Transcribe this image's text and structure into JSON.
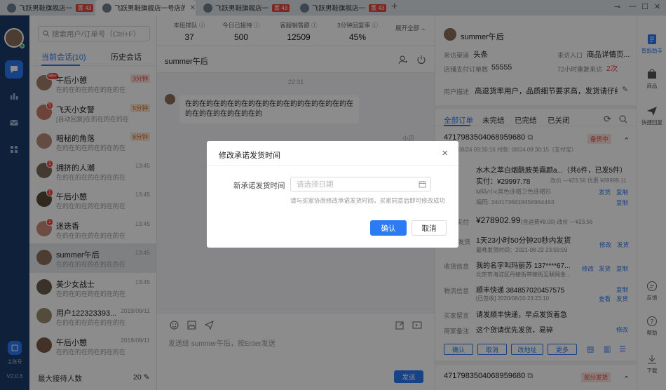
{
  "tabs": [
    {
      "label": "飞跃男鞋旗舰店一",
      "badge": "置 43"
    },
    {
      "label": "飞跃男鞋旗舰店一号店的",
      "badge": ""
    },
    {
      "label": "飞跃男鞋旗舰店一",
      "badge": "置 43"
    },
    {
      "label": "飞跃男鞋旗舰店一",
      "badge": "置 43"
    }
  ],
  "rail": {
    "version": "V2.0.6",
    "account_label": "主账号"
  },
  "conv": {
    "search_placeholder": "搜索用户/订单号（Ctrl+F）",
    "tab_current": "当前会话(10)",
    "tab_history": "历史会话",
    "items": [
      {
        "name": "午后小憩",
        "preview": "在的在的在的在的在的在",
        "time": "3分钟",
        "time_style": "red",
        "badge": "99+",
        "avatar_color": "#a0806a"
      },
      {
        "name": "飞天小女警",
        "preview": "[自动回复]在的在的在的在",
        "time": "5分钟",
        "time_style": "warn",
        "badge": "5",
        "avatar_color": "#c97a6a"
      },
      {
        "name": "暗秘的角落",
        "preview": "在的在的在的在的在的在",
        "time": "8分钟",
        "time_style": "warn",
        "badge": "",
        "avatar_color": "#b88a78"
      },
      {
        "name": "拥挤的人潮",
        "preview": "在的在的在的在的在的在",
        "time": "13:45",
        "time_style": "",
        "badge": "1",
        "avatar_color": "#7a6a5a"
      },
      {
        "name": "午后小憩",
        "preview": "在的在的在的在的在的在",
        "time": "13:45",
        "time_style": "",
        "badge": "1",
        "avatar_color": "#5a4a3a"
      },
      {
        "name": "迷迭香",
        "preview": "在的在的在的在的在的在",
        "time": "13:45",
        "time_style": "",
        "badge": "1",
        "avatar_color": "#c98a7a"
      },
      {
        "name": "summer午后",
        "preview": "在的在的在的在的在的在",
        "time": "13:45",
        "time_style": "",
        "badge": "",
        "avatar_color": "#8a6d5a"
      },
      {
        "name": "美少女战士",
        "preview": "在的在的在的在的在的在",
        "time": "13:45",
        "time_style": "",
        "badge": "",
        "avatar_color": "#6a5a4a"
      },
      {
        "name": "用户122323393...",
        "preview": "在的在的在的在的在的在",
        "time": "2019/09/11",
        "time_style": "",
        "badge": "",
        "avatar_color": "#9a8a6a"
      },
      {
        "name": "午后小憩",
        "preview": "在的在的在的在的在的在",
        "time": "2019/09/11",
        "time_style": "",
        "badge": "",
        "avatar_color": "#7a5a4a"
      }
    ],
    "max_label": "最大接待人数",
    "max_value": "20"
  },
  "stats": [
    {
      "label": "本班排队",
      "value": "37"
    },
    {
      "label": "今日已接待",
      "value": "500"
    },
    {
      "label": "客服销售额",
      "value": "12509"
    },
    {
      "label": "3分钟回复率",
      "value": "45%"
    }
  ],
  "expand_label": "展开全部",
  "chat": {
    "title": "summer午后",
    "timestamp": "22:31",
    "message": "在的在的在的在的在的在的在的在的的在的在的在的在的在的在的在的在的在的",
    "note": "小贝",
    "placeholder": "发送给 summer午后，按Enter发送",
    "send_label": "发送"
  },
  "customer": {
    "name": "summer午后",
    "source_label": "来访渠道",
    "source_value": "头条",
    "entry_label": "来访入口",
    "entry_value": "商品详情页...",
    "paid_label": "店铺支付订单数",
    "paid_value": "55555",
    "repeat_label": "72小时重复来访",
    "repeat_value": "2次",
    "desc_label": "用户描述",
    "desc_value": "高退货率用户，品质细节要求高，发货请仔细..."
  },
  "order_tabs": [
    "全部订单",
    "未完结",
    "已完结",
    "已关闭"
  ],
  "order": {
    "id": "4717983504068959680",
    "status": "备货中",
    "time": "下单: 08/24 09:30:16  付款: 08/24 09:30:15（支付宝）",
    "product": "水木之萃白烟酰胺美霜颜a...（共6件，已发5件）",
    "price": "实付：¥29997.78",
    "price_note": "改价 —¥23.56 优惠 ¥69999.11",
    "spec": "M码/小c黑色连帽卫色连帽衫",
    "code": "编码: 3441736818456964463",
    "total_label": "实付",
    "total": "¥278902.99",
    "total_note": "(含运费¥8.00)  改价 —¥23.56",
    "ship_label": "发货",
    "ship_promise": "1天23小时50分钟20秒内发货",
    "ship_latest": "最晚发货时间：2021-08-22 23:59:59",
    "recv_label": "收货信息",
    "recv_name": "我的名字叫玛丽苏  137****67...",
    "recv_addr": "北京市海淀区丹棱街带棱街互联网金...",
    "logi_label": "物流信息",
    "logi_value": "顺丰快递 384857020457575",
    "logi_time": "[已签收] 2020/08/10 23:23:10",
    "buyer_label": "买家留言",
    "buyer_msg": "请发顺丰快递，早点发货着急",
    "seller_label": "商家备注",
    "seller_msg": "这个货请优先发货，易碎",
    "actions": [
      "确认",
      "取消",
      "改地址",
      "更多"
    ],
    "edit": "修改",
    "ship": "发货",
    "copy": "复制",
    "check": "查看",
    "next_id": "4717983504068959680",
    "next_status": "部分发货"
  },
  "sidebar": [
    {
      "label": "智能助手",
      "icon": "assistant-icon"
    },
    {
      "label": "商品",
      "icon": "product-icon"
    },
    {
      "label": "快捷回复",
      "icon": "quick-reply-icon"
    },
    {
      "label": "反馈",
      "icon": "feedback-icon"
    },
    {
      "label": "帮助",
      "icon": "help-icon"
    },
    {
      "label": "下载",
      "icon": "download-icon"
    }
  ],
  "modal": {
    "title": "修改承诺发货时间",
    "field_label": "新承诺发货时间",
    "placeholder": "请选择日期",
    "hint": "请与买家协商修改承诺发货时间，买家同意后即可修改成功",
    "ok": "确认",
    "cancel": "取消"
  },
  "colors": {
    "accent": "#2a7bf4",
    "rail": "#1a3b6a",
    "danger": "#e0453c"
  }
}
